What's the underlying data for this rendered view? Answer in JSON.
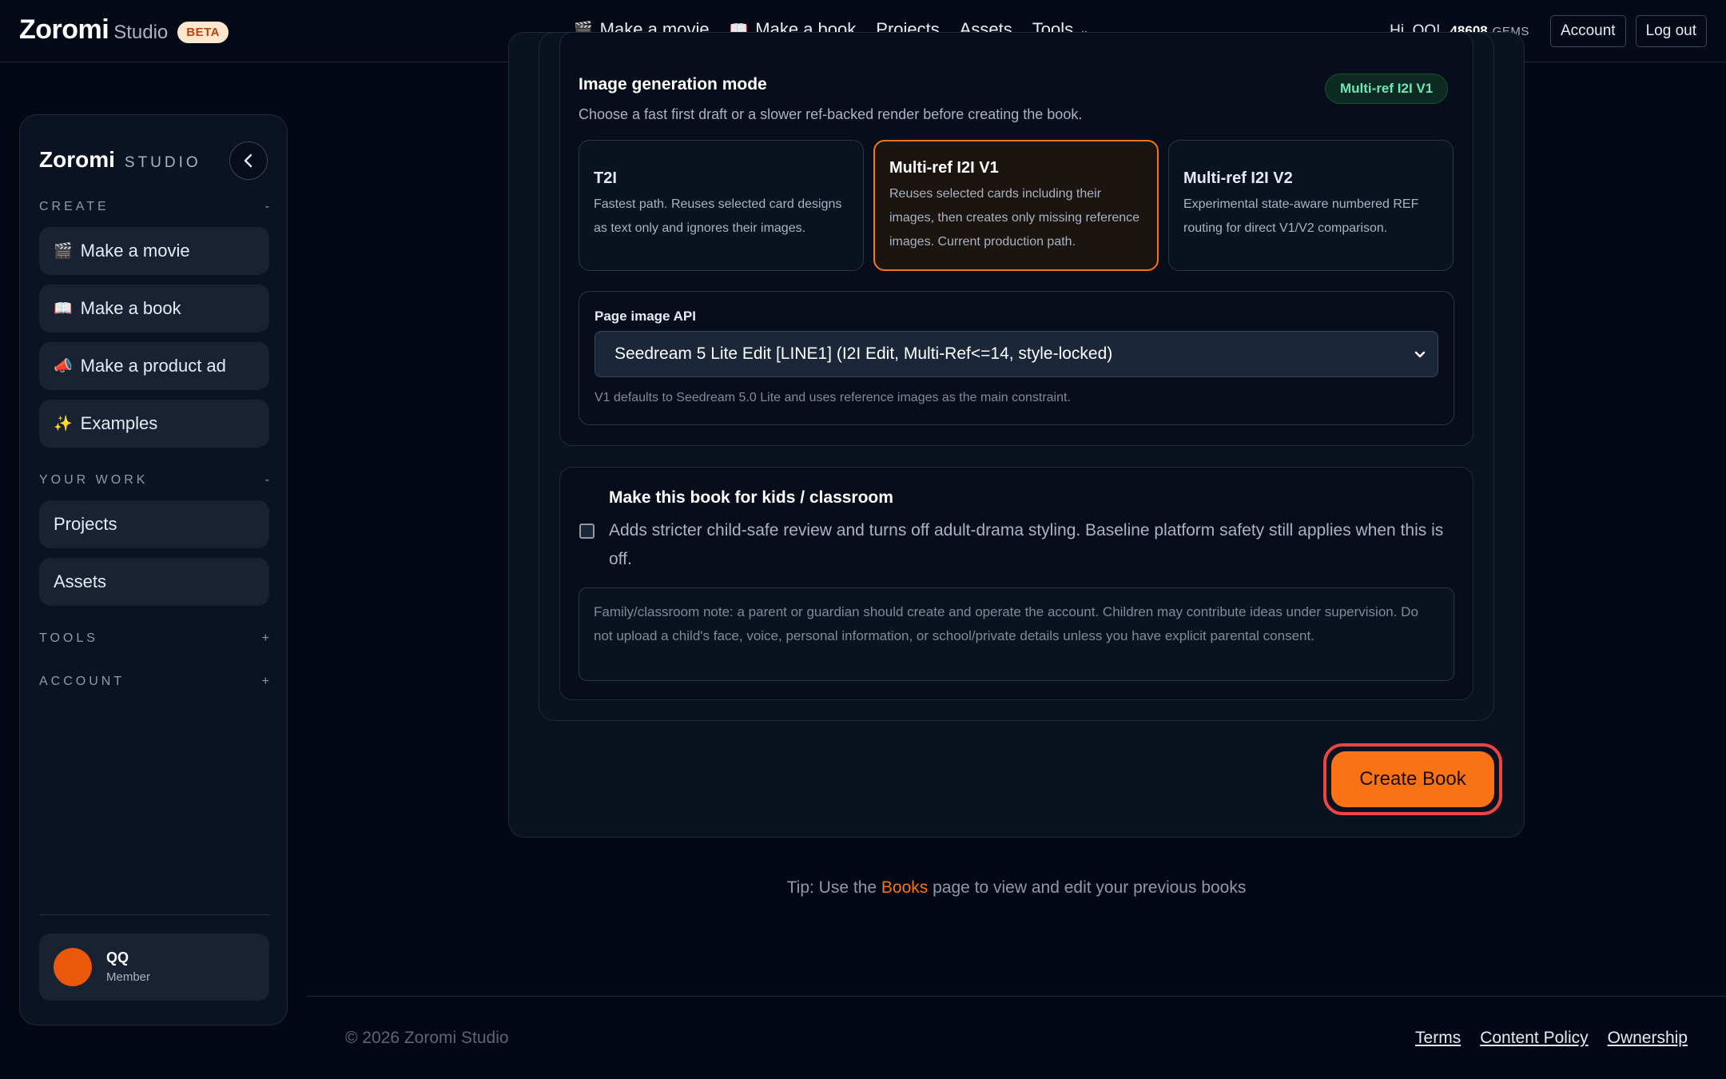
{
  "topnav": {
    "brand": "Zoromi",
    "brand_sub": "Studio",
    "beta": "BETA",
    "links": [
      {
        "icon": "🎬",
        "label": "Make a movie"
      },
      {
        "icon": "📖",
        "label": "Make a book"
      },
      {
        "icon": "",
        "label": "Projects"
      },
      {
        "icon": "",
        "label": "Assets"
      },
      {
        "icon": "",
        "label": "Tools"
      }
    ],
    "tools_chevron": "⌄",
    "greeting": "Hi, QQ!",
    "gems": "48608",
    "gems_label": "GEMS",
    "account": "Account",
    "logout": "Log out"
  },
  "sidebar": {
    "brand": "Zoromi",
    "brand_sub": "STUDIO",
    "collapse_icon": "‹",
    "sections": {
      "create": {
        "label": "CREATE",
        "toggle": "-"
      },
      "your_work": {
        "label": "YOUR WORK",
        "toggle": "-"
      },
      "tools": {
        "label": "TOOLS",
        "toggle": "+"
      },
      "account": {
        "label": "ACCOUNT",
        "toggle": "+"
      }
    },
    "create_items": [
      {
        "icon": "🎬",
        "label": "Make a movie"
      },
      {
        "icon": "📖",
        "label": "Make a book"
      },
      {
        "icon": "📣",
        "label": "Make a product ad"
      },
      {
        "icon": "✨",
        "label": "Examples"
      }
    ],
    "work_items": [
      {
        "label": "Projects"
      },
      {
        "label": "Assets"
      }
    ],
    "user": {
      "name": "QQ",
      "role": "Member",
      "avatar_color": "#ea580c"
    }
  },
  "mode": {
    "title": "Image generation mode",
    "description": "Choose a fast first draft or a slower ref-backed render before creating the book.",
    "badge": "Multi-ref I2I V1",
    "options": [
      {
        "title": "T2I",
        "desc": "Fastest path. Reuses selected card designs as text only and ignores their images.",
        "selected": false
      },
      {
        "title": "Multi-ref I2I V1",
        "desc": "Reuses selected cards including their images, then creates only missing reference images. Current production path.",
        "selected": true
      },
      {
        "title": "Multi-ref I2I V2",
        "desc": "Experimental state-aware numbered REF routing for direct V1/V2 comparison.",
        "selected": false
      }
    ],
    "api": {
      "label": "Page image API",
      "selected": "Seedream 5 Lite Edit [LINE1] (I2I Edit, Multi-Ref<=14, style-locked)",
      "note": "V1 defaults to Seedream 5.0 Lite and uses reference images as the main constraint."
    }
  },
  "kids": {
    "checked": false,
    "title": "Make this book for kids / classroom",
    "desc": "Adds stricter child-safe review and turns off adult-drama styling. Baseline platform safety still applies when this is off.",
    "note": "Family/classroom note: a parent or guardian should create and operate the account. Children may contribute ideas under supervision. Do not upload a child's face, voice, personal information, or school/private details unless you have explicit parental consent."
  },
  "create_button": "Create Book",
  "tip": {
    "prefix": "Tip: Use the ",
    "link": "Books",
    "suffix": " page to view and edit your previous books"
  },
  "footer": {
    "copyright": "© 2026 Zoromi Studio",
    "links": [
      "Terms",
      "Content Policy",
      "Ownership"
    ]
  },
  "colors": {
    "accent": "#f97316",
    "background": "#030814",
    "badge_green": "#6ee7b7",
    "focus_ring": "#ef4444"
  }
}
